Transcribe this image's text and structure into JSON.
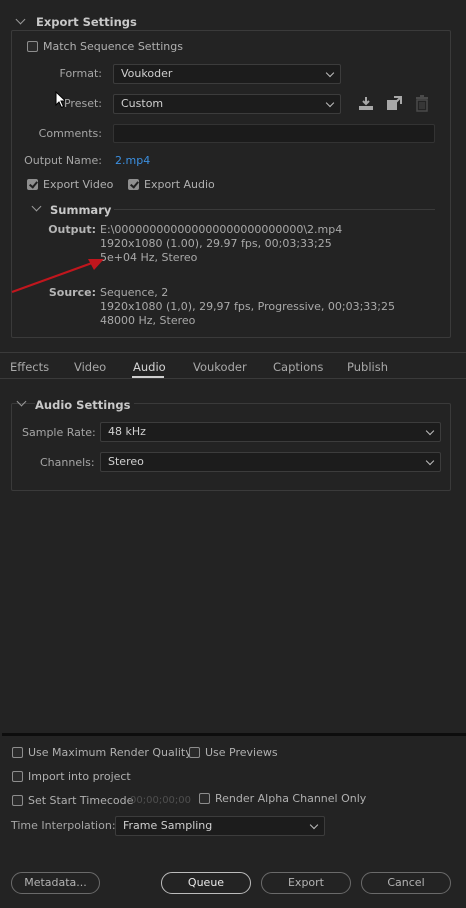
{
  "export_settings": {
    "title": "Export Settings",
    "match_sequence": {
      "label": "Match Sequence Settings",
      "checked": false
    },
    "format": {
      "label": "Format:",
      "value": "Voukoder"
    },
    "preset": {
      "label": "Preset:",
      "value": "Custom"
    },
    "comments": {
      "label": "Comments:",
      "value": ""
    },
    "output_name": {
      "label": "Output Name:",
      "value": "2.mp4"
    },
    "export_video": {
      "label": "Export Video",
      "checked": true
    },
    "export_audio": {
      "label": "Export Audio",
      "checked": true
    },
    "summary": {
      "title": "Summary",
      "output_label": "Output:",
      "output_lines": [
        "E:\\000000000000000000000000000\\2.mp4",
        "1920x1080 (1.00), 29.97 fps, 00;03;33;25",
        "5e+04 Hz, Stereo"
      ],
      "source_label": "Source:",
      "source_lines": [
        "Sequence, 2",
        "1920x1080 (1,0), 29,97 fps, Progressive, 00;03;33;25",
        "48000 Hz, Stereo"
      ]
    }
  },
  "tabs": [
    {
      "label": "Effects",
      "active": false
    },
    {
      "label": "Video",
      "active": false
    },
    {
      "label": "Audio",
      "active": true
    },
    {
      "label": "Voukoder",
      "active": false
    },
    {
      "label": "Captions",
      "active": false
    },
    {
      "label": "Publish",
      "active": false
    }
  ],
  "audio_settings": {
    "title": "Audio Settings",
    "sample_rate": {
      "label": "Sample Rate:",
      "value": "48 kHz"
    },
    "channels": {
      "label": "Channels:",
      "value": "Stereo"
    }
  },
  "bottom": {
    "max_render_quality": {
      "label": "Use Maximum Render Quality",
      "checked": false
    },
    "use_previews": {
      "label": "Use Previews",
      "checked": false
    },
    "import_into_project": {
      "label": "Import into project",
      "checked": false
    },
    "set_start_timecode": {
      "label": "Set Start Timecode",
      "checked": false,
      "timecode": "00;00;00;00"
    },
    "render_alpha": {
      "label": "Render Alpha Channel Only",
      "checked": false
    },
    "time_interpolation": {
      "label": "Time Interpolation:",
      "value": "Frame Sampling"
    }
  },
  "buttons": {
    "metadata": "Metadata...",
    "queue": "Queue",
    "export": "Export",
    "cancel": "Cancel"
  },
  "colors": {
    "background": "#232323",
    "link": "#3b8fe0",
    "annotation_arrow": "#c0161d"
  },
  "icons": [
    "chevron-down-icon",
    "cursor-icon",
    "save-preset-icon",
    "import-preset-icon",
    "delete-preset-icon",
    "arrow-annotation-icon"
  ]
}
